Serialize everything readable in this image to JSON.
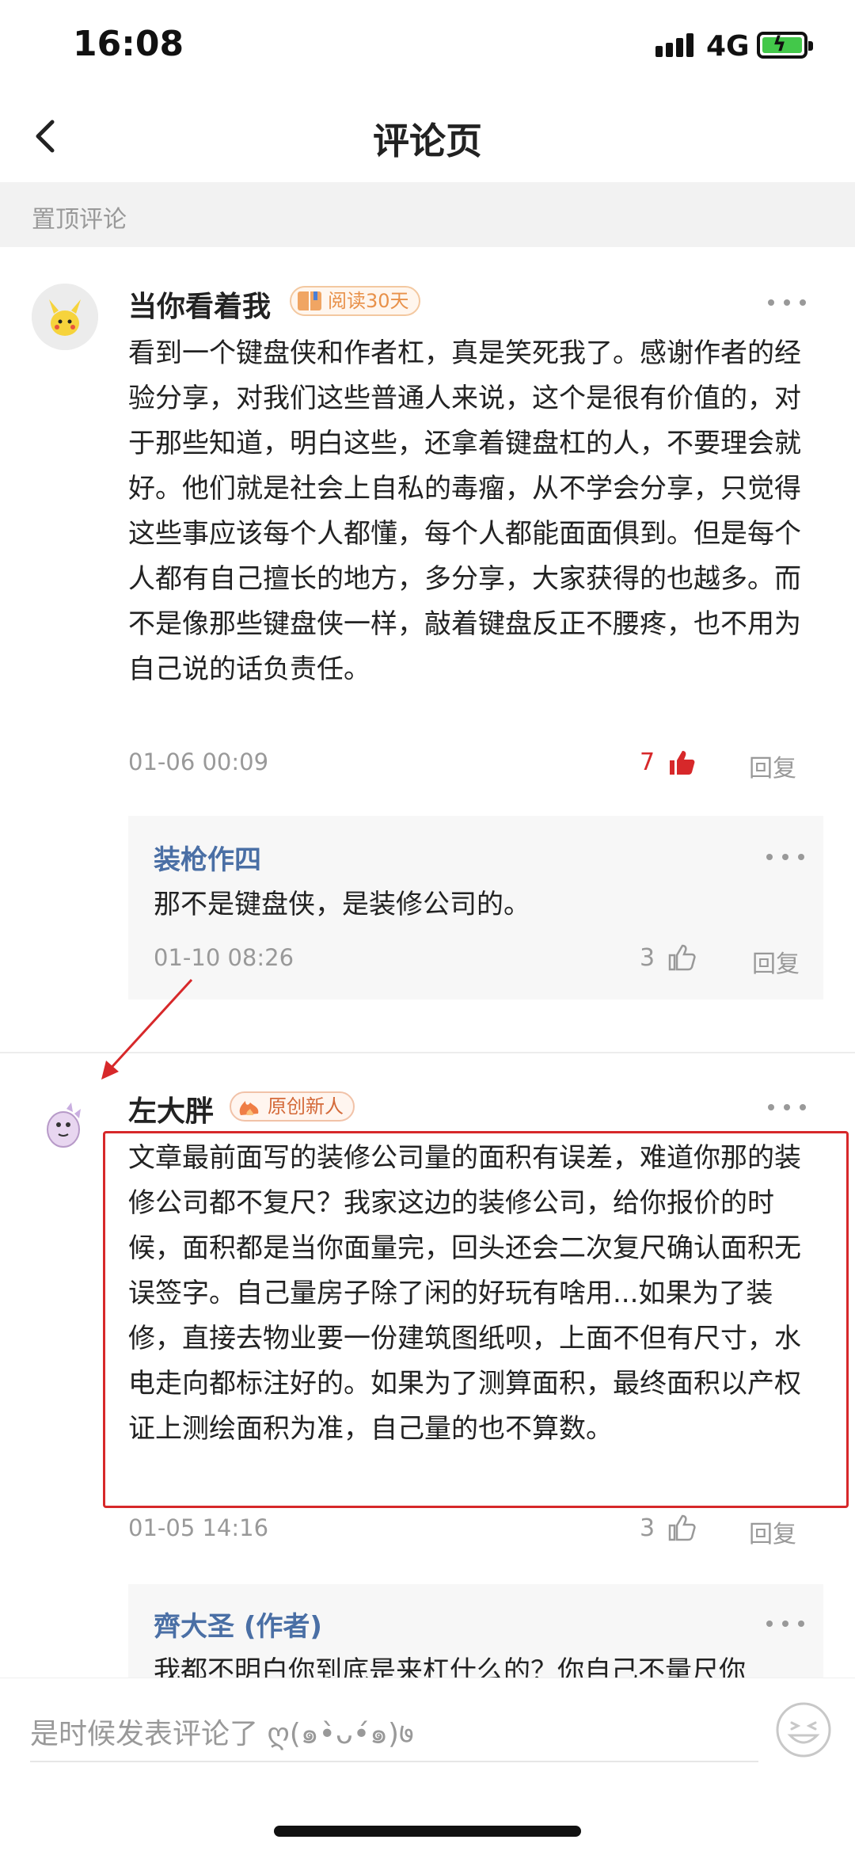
{
  "status_bar": {
    "time": "16:08",
    "network": "4G"
  },
  "nav": {
    "title": "评论页"
  },
  "section": {
    "label": "置顶评论"
  },
  "comments": [
    {
      "user": "当你看着我",
      "badge": "阅读30天",
      "text": "看到一个键盘侠和作者杠，真是笑死我了。感谢作者的经验分享，对我们这些普通人来说，这个是很有价值的，对于那些知道，明白这些，还拿着键盘杠的人，不要理会就好。他们就是社会上自私的毒瘤，从不学会分享，只觉得这些事应该每个人都懂，每个人都能面面俱到。但是每个人都有自己擅长的地方，多分享，大家获得的也越多。而不是像那些键盘侠一样，敲着键盘反正不腰疼，也不用为自己说的话负责任。",
      "date": "01-06 00:09",
      "likes": "7",
      "reply_label": "回复",
      "replies": [
        {
          "user": "装枪作四",
          "text": "那不是键盘侠，是装修公司的。",
          "date": "01-10 08:26",
          "likes": "3",
          "reply_label": "回复"
        }
      ]
    },
    {
      "user": "左大胖",
      "badge": "原创新人",
      "text": "文章最前面写的装修公司量的面积有误差，难道你那的装修公司都不复尺？我家这边的装修公司，给你报价的时候，面积都是当你面量完，回头还会二次复尺确认面积无误签字。自己量房子除了闲的好玩有啥用...如果为了装修，直接去物业要一份建筑图纸呗，上面不但有尺寸，水电走向都标注好的。如果为了测算面积，最终面积以产权证上测绘面积为准，自己量的也不算数。",
      "date": "01-05 14:16",
      "likes": "3",
      "reply_label": "回复",
      "replies": [
        {
          "user": "齊大圣 (作者)",
          "text": "我都不明白你到底是来杠什么的？你自己不量尺你"
        }
      ]
    }
  ],
  "input": {
    "placeholder": "是时候发表评论了 ღ(๑•̀ᴗ•́๑)७"
  },
  "colors": {
    "liked": "#d7282a",
    "username_link": "#4a6fa5",
    "highlight": "#d7282a"
  }
}
